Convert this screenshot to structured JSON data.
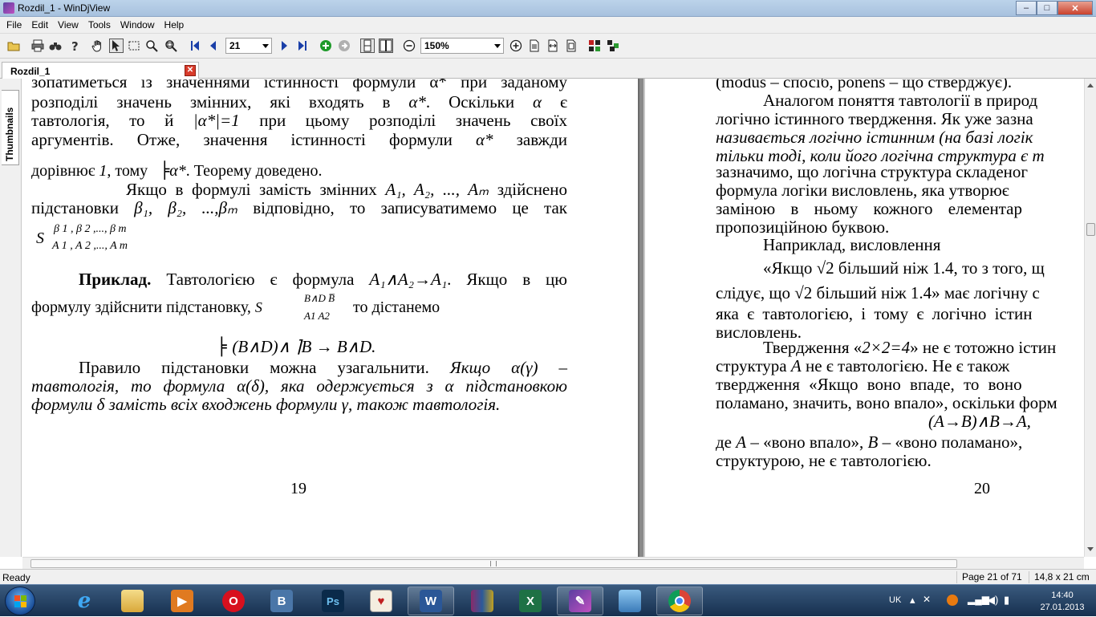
{
  "window": {
    "title": "Rozdil_1 - WinDjView",
    "buttons": {
      "minimize": "‒",
      "maximize": "□",
      "close": "✕"
    }
  },
  "menu": [
    "File",
    "Edit",
    "View",
    "Tools",
    "Window",
    "Help"
  ],
  "toolbar": {
    "page_number": "21",
    "zoom": "150%"
  },
  "tab": {
    "label": "Rozdil_1",
    "close": "✕"
  },
  "sidebar": {
    "thumbnails_label": "Thumbnails"
  },
  "page_left": {
    "lines": {
      "l0": "зопатиметься із значеннями істинності формули α* при заданому",
      "l1a": "розподілі значень змінних, які входять в ",
      "l1b": "α*",
      "l1c": ". Оскільки ",
      "l1d": "α",
      "l1e": " є",
      "l2a": "тавтологія, то й ",
      "l2b": "|α*|=1",
      "l2c": " при цьому розподілі значень своїх",
      "l3a": "аргументів. Отже, значення істинності формули ",
      "l3b": "α*",
      "l3c": " завжди",
      "l4a": "дорівнює ",
      "l4b": "1",
      "l4c": ", тому ",
      "l4d": "╞",
      "l4e": "α*",
      "l4f": ". Теорему доведено.",
      "l5a": "Якщо в формулі замість змінних ",
      "l5b": "A₁, A₂, ..., Aₘ",
      "l5c": " здійснено",
      "l6a": "підстановки ",
      "l6b": "β₁, β₂, ...,βₘ",
      "l6c": " відповідно, то записуватимемо це так",
      "s_main": "S",
      "s_sup": "β 1 , β 2 ,...,  β m",
      "s_sub": "A 1 , A 2 ,...,  A m",
      "ex_bold": "Приклад.",
      "ex_a": " Тавтологією є формула ",
      "ex_b": "A₁∧A₂→A₁",
      "ex_c": ". Якщо в цю",
      "l8a": "формулу здійснити підстановку, ",
      "l8s": "S",
      "l8sup": "B∧D  B̅",
      "l8sub": "A1     A2",
      "l8c": " то дістанемо",
      "l9a": "╞ ",
      "l9b": "(B∧D)∧ ⌉B → B∧D.",
      "l10a": "Правило підстановки можна узагальнити. ",
      "l10b": "Якщо α(γ) –",
      "l11": "тавтологія, то формула α(δ), яка одержується з α підстановкою",
      "l12": "формули δ замість всіх входжень формули γ, також тавтологія."
    },
    "page_num": "19"
  },
  "page_right": {
    "lines": {
      "r0": "(modus – спосіб, ponens – що стверджує).",
      "r1": "Аналогом поняття тавтології в природ",
      "r2a": "логічно істинного твердження. Як уже зазна",
      "r3": "називається логічно істинним (на базі логік",
      "r4": "тільки тоді, коли його логічна структура є т",
      "r5": "зазначимо, що логічна структура складеног",
      "r6": "формула логіки висловлень, яка утворює",
      "r7": "заміною в ньому кожного елементар",
      "r8": "пропозиційною буквою.",
      "r9": "Наприклад, висловлення",
      "r10a": "«Якщо ",
      "r10b": "√2",
      "r10c": " більший ніж 1.4, то з того, щ",
      "r11a": "слідує, що ",
      "r11b": "√2",
      "r11c": " більший ніж 1.4» має логічну с",
      "r12": "яка є тавтологією, і тому є логічно істин",
      "r13": "висловлень.",
      "r14a": "Твердження «",
      "r14b": "2×2=4",
      "r14c": "» не є тотожно істин",
      "r15a": "структура ",
      "r15b": "A",
      "r15c": " не є тавтологією. Не є також",
      "r16": "твердження «Якщо воно впаде, то воно",
      "r17": "поламано, значить, воно впало», оскільки форм",
      "r18": "(A→B)∧B→A,",
      "r19a": "де ",
      "r19b": "A",
      "r19c": " – «воно впало», ",
      "r19d": "B",
      "r19e": " – «воно поламано»,",
      "r20": "структурою, не є тавтологією."
    },
    "page_num": "20"
  },
  "status": {
    "ready": "Ready",
    "page_info": "Page 21 of 71",
    "page_size": "14,8 x 21 cm"
  },
  "taskbar": {
    "apps": [
      "internet-explorer",
      "file-explorer",
      "media-player",
      "opera",
      "vk",
      "photoshop",
      "solitaire",
      "word",
      "winrar",
      "excel",
      "windjview",
      "image-viewer",
      "chrome"
    ],
    "lang": "UK",
    "time": "14:40",
    "date": "27.01.2013"
  },
  "colors": {
    "accent": "#1a4e98",
    "titlebar": "#bcd3ea"
  }
}
